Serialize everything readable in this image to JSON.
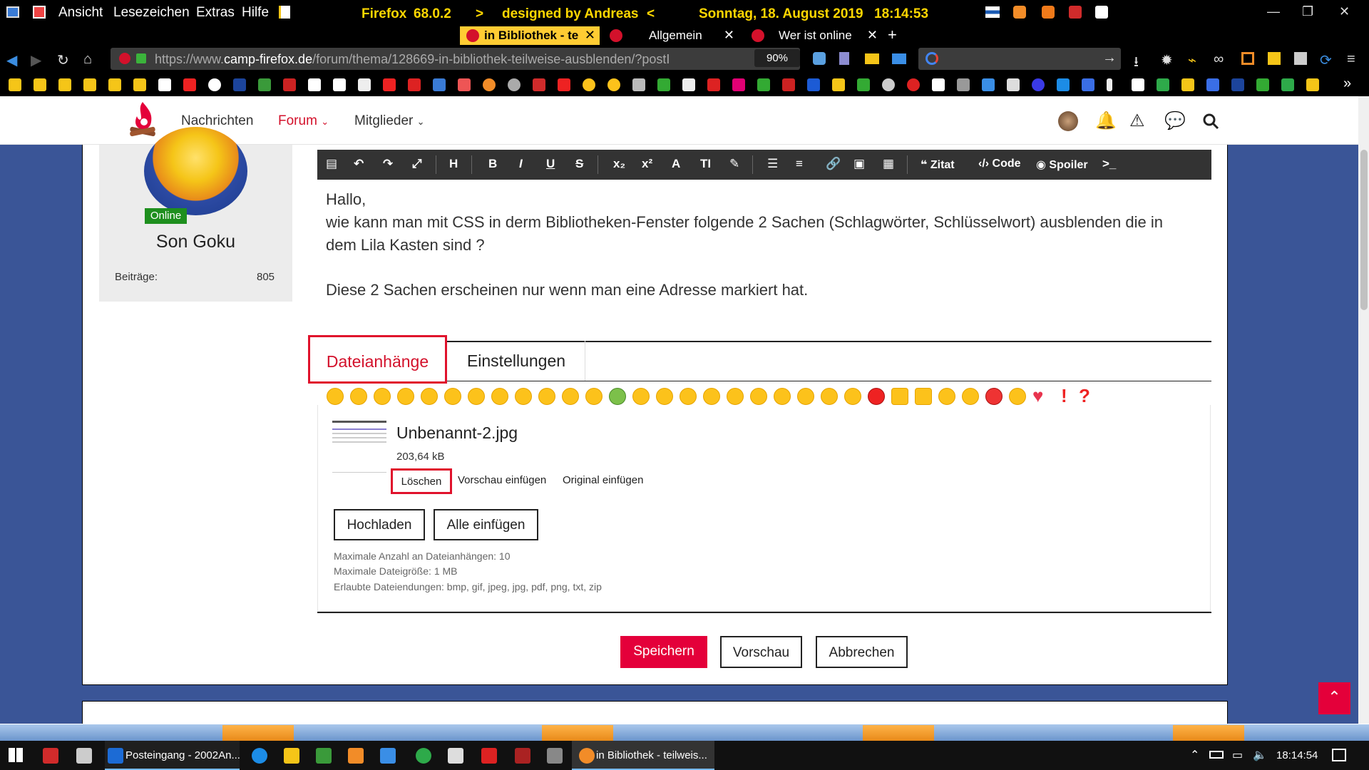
{
  "menubar": {
    "items": [
      "Ansicht",
      "Lesezeichen",
      "Extras",
      "Hilfe"
    ],
    "browser": "Firefox",
    "version": "68.0.2",
    "arrow_left": ">",
    "designed": "designed by Andreas",
    "arrow_right": "<",
    "date": "Sonntag, 18. August 2019",
    "time": "18:14:53"
  },
  "tabs": [
    {
      "label": "in Bibliothek - te"
    },
    {
      "label": "Allgemein"
    },
    {
      "label": "Wer ist online"
    }
  ],
  "new_tab": "+",
  "navbar": {
    "url_prefix": "https://www.",
    "url_domain": "camp-firefox.de",
    "url_path": "/forum/thema/128669-in-bibliothek-teilweise-ausblenden/?postI",
    "zoom": "90%"
  },
  "site_nav": {
    "items": [
      "Nachrichten",
      "Forum",
      "Mitglieder"
    ]
  },
  "user": {
    "status": "Online",
    "name": "Son Goku",
    "posts_label": "Beiträge:",
    "posts_value": "805"
  },
  "editor": {
    "toolbar": {
      "quote": "Zitat",
      "code": "Code",
      "spoiler": "Spoiler"
    },
    "lines": [
      "Hallo,",
      "wie kann man mit CSS in derm Bibliotheken-Fenster folgende 2 Sachen (Schlagwörter, Schlüsselwort) ausblenden die in",
      "dem Lila Kasten sind ?",
      "Diese 2 Sachen erscheinen nur wenn man eine Adresse markiert hat."
    ]
  },
  "editor_tabs": {
    "attachments": "Dateianhänge",
    "settings": "Einstellungen"
  },
  "attachment": {
    "filename": "Unbenannt-2.jpg",
    "size": "203,64 kB",
    "delete": "Löschen",
    "insert_preview": "Vorschau einfügen",
    "insert_original": "Original einfügen"
  },
  "attachment_buttons": {
    "upload": "Hochladen",
    "insert_all": "Alle einfügen"
  },
  "attachment_info": [
    "Maximale Anzahl an Dateianhängen: 10",
    "Maximale Dateigröße: 1 MB",
    "Erlaubte Dateiendungen: bmp, gif, jpeg, jpg, pdf, png, txt, zip"
  ],
  "form_buttons": {
    "save": "Speichern",
    "preview": "Vorschau",
    "cancel": "Abbrechen"
  },
  "taskbar": {
    "mail": "Posteingang - 2002An...",
    "firefox": "in Bibliothek - teilweis...",
    "clock": "18:14:54"
  },
  "colors": {
    "accent": "#e4003a",
    "highlight_border": "#e0122c",
    "page_bg": "#3a5597"
  }
}
